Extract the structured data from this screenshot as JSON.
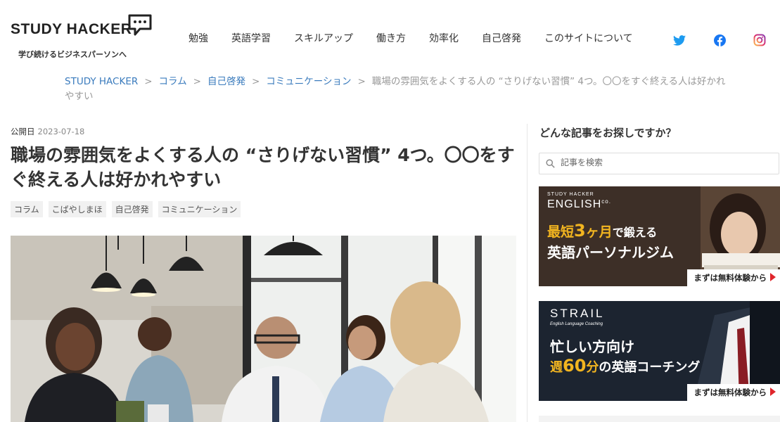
{
  "header": {
    "logo_text": "STUDY HACKER",
    "tagline": "学び続けるビジネスパーソンへ",
    "nav": [
      {
        "label": "勉強"
      },
      {
        "label": "英語学習"
      },
      {
        "label": "スキルアップ"
      },
      {
        "label": "働き方"
      },
      {
        "label": "効率化"
      },
      {
        "label": "自己啓発"
      },
      {
        "label": "このサイトについて"
      }
    ],
    "social": [
      {
        "icon": "twitter-icon",
        "color": "#1d9bf0"
      },
      {
        "icon": "facebook-icon",
        "color": "#1877f2"
      },
      {
        "icon": "instagram-icon",
        "color": "#e1306c"
      }
    ]
  },
  "breadcrumb": {
    "items": [
      "STUDY HACKER",
      "コラム",
      "自己啓発",
      "コミュニケーション"
    ],
    "separator": ">",
    "current": "職場の雰囲気をよくする人の “さりげない習慣” 4つ。〇〇をすぐ終える人は好かれやすい"
  },
  "article": {
    "published_label": "公開日",
    "published_date": "2023-07-18",
    "title": "職場の雰囲気をよくする人の “さりげない習慣” 4つ。〇〇をすぐ終える人は好かれやすい",
    "tags": [
      "コラム",
      "こばやしまほ",
      "自己啓発",
      "コミュニケーション"
    ]
  },
  "sidebar": {
    "title": "どんな記事をお探しですか？",
    "search_placeholder": "記事を検索",
    "banner1": {
      "brand_top": "STUDY HACKER",
      "brand": "ENGLISH",
      "brand_suffix": "co.",
      "line1_a": "最短",
      "line1_b": "3",
      "line1_c": "ヶ月",
      "line1_d": "で鍛える",
      "line2": "英語パーソナルジム",
      "cta": "まずは無料体験から"
    },
    "banner2": {
      "brand": "STRAIL",
      "brand_sub": "English Language Coaching",
      "line1": "忙しい方向け",
      "line2_a": "週",
      "line2_b": "60",
      "line2_c": "分",
      "line2_d": "の英語コーチング",
      "cta": "まずは無料体験から"
    }
  },
  "colors": {
    "link": "#3a7bbd",
    "accent_gold": "#f2b520",
    "cta_arrow": "#e0252b"
  }
}
